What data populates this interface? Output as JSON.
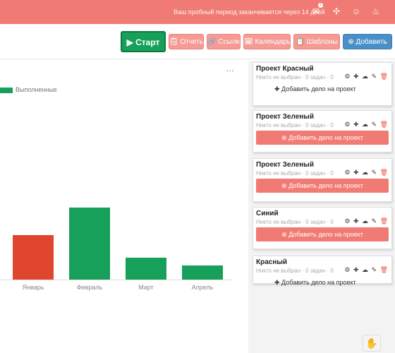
{
  "topbar": {
    "notice": "Ваш пробный период заканчивается через 14 дней",
    "badge_count": "1",
    "icons": [
      "bell-icon",
      "puzzle-icon",
      "user-icon",
      "flame-icon"
    ]
  },
  "toolbar": {
    "start_label": "▶ Старт",
    "b1": "🗒 Отчеты",
    "b2": "🔗 Ссылки",
    "b3": "🗓 Календарь",
    "b4": "📋 Шаблоны",
    "b5": "⊕ Добавить"
  },
  "chart_data": {
    "type": "bar",
    "categories": [
      "Январь",
      "Февраль",
      "Март",
      "Апрель"
    ],
    "values": [
      62,
      100,
      30,
      20
    ],
    "colors": [
      "#e0462f",
      "#16a05a",
      "#16a05a",
      "#16a05a"
    ],
    "ylim": [
      0,
      110
    ],
    "legend": [
      "Выполненные"
    ],
    "grid": false
  },
  "cards": [
    {
      "title": "Проект Красный",
      "sub": "Никто не выбран · 0 задач · 0",
      "action": "✚ Добавить дело на проект",
      "style": "link"
    },
    {
      "title": "Проект Зеленый",
      "sub": "Никто не выбран · 0 задач · 0",
      "action": "⊕ Добавить дело на проект",
      "style": "button"
    },
    {
      "title": "Проект Зеленый",
      "sub": "Никто не выбран · 0 задач · 0",
      "action": "⊕ Добавить дело на проект",
      "style": "button"
    },
    {
      "title": "Синий",
      "sub": "Никто не выбран · 0 задач · 0",
      "action": "⊕ Добавить дело на проект",
      "style": "button"
    },
    {
      "title": "Красный",
      "sub": "Никто не выбран · 0 задач · 0",
      "action": "✚ Добавить дело на проект",
      "style": "link"
    }
  ],
  "card_icons": "⚙ ✚ ☁ ✎",
  "card_trash": "🗑",
  "chart_menu": "…",
  "fab_icon": "✋"
}
